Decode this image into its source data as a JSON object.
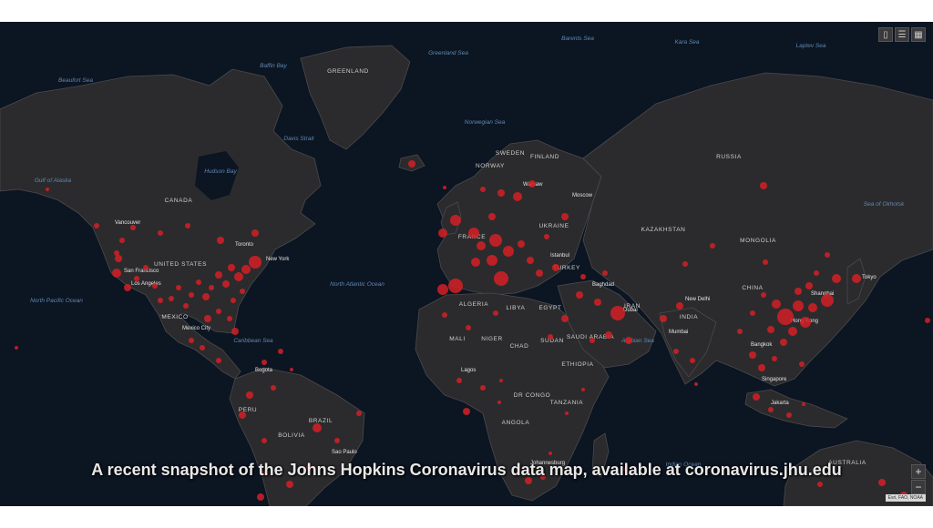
{
  "map": {
    "caption": "A recent snapshot of the Johns Hopkins Coronavirus data map, available at coronavirus.jhu.edu",
    "accent_color": "#d32026",
    "background_color": "#0c1522",
    "land_color": "#2b2b2d",
    "ocean_labels": [
      "Beaufort Sea",
      "Baffin Bay",
      "Greenland Sea",
      "Barents Sea",
      "Kara Sea",
      "Laptev Sea",
      "Gulf of Alaska",
      "Davis Strait",
      "Hudson Bay",
      "Norwegian Sea",
      "North Atlantic Ocean",
      "North Pacific Ocean",
      "Caribbean Sea",
      "Arabian Sea",
      "Indian Ocean",
      "Sea of Okhotsk"
    ],
    "country_labels": [
      "GREENLAND",
      "UNITED STATES",
      "CANADA",
      "RUSSIA",
      "KAZAKHSTAN",
      "MONGOLIA",
      "CHINA",
      "INDIA",
      "ALGERIA",
      "LIBYA",
      "EGYPT",
      "MALI",
      "NIGER",
      "CHAD",
      "SUDAN",
      "ETHIOPIA",
      "DR CONGO",
      "TANZANIA",
      "ANGOLA",
      "BRAZIL",
      "PERU",
      "BOLIVIA",
      "AUSTRALIA",
      "MEXICO",
      "SWEDEN",
      "FINLAND",
      "NORWAY",
      "UKRAINE",
      "TURKEY",
      "FRANCE",
      "SAUDI ARABIA",
      "IRAN"
    ],
    "city_labels": [
      "Vancouver",
      "San Francisco",
      "Los Angeles",
      "Mexico City",
      "New York",
      "Toronto",
      "Bogota",
      "Sao Paulo",
      "Moscow",
      "Istanbul",
      "Baghdad",
      "Dubai",
      "Tokyo",
      "Shanghai",
      "Hong Kong",
      "Singapore",
      "Jakarta",
      "New Delhi",
      "Mumbai",
      "Bangkok",
      "Johannesburg",
      "Warsaw",
      "Lagos"
    ],
    "toolbar_icons": [
      "bookmark-icon",
      "list-icon",
      "grid-icon"
    ],
    "zoom_in": "+",
    "zoom_out": "−",
    "attribution": "Esri, FAO, NOAA"
  }
}
